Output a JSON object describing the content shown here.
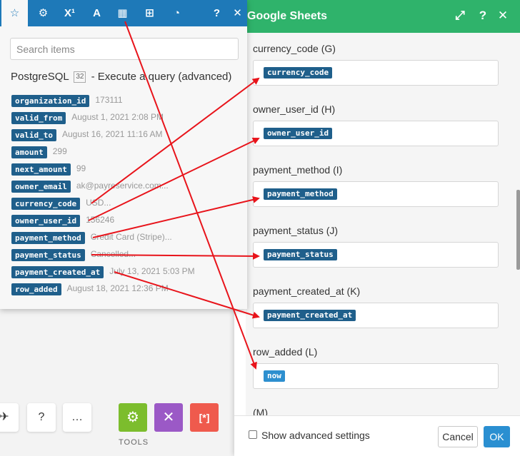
{
  "gs": {
    "title": "Google Sheets",
    "header_icons": [
      "expand-icon",
      "help-icon",
      "close-icon"
    ],
    "fields": [
      {
        "label": "currency_code (G)",
        "value": "currency_code"
      },
      {
        "label": "owner_user_id (H)",
        "value": "owner_user_id"
      },
      {
        "label": "payment_method (I)",
        "value": "payment_method"
      },
      {
        "label": "payment_status (J)",
        "value": "payment_status"
      },
      {
        "label": "payment_created_at (K)",
        "value": "payment_created_at"
      },
      {
        "label": "row_added (L)",
        "value": "now"
      },
      {
        "label": "(M)",
        "value": ""
      }
    ],
    "advanced_label": "Show advanced settings",
    "cancel_label": "Cancel",
    "ok_label": "OK"
  },
  "mapper": {
    "tabs": [
      "star-icon",
      "gear-icon",
      "superscript-icon",
      "text-icon",
      "calendar-icon",
      "table-icon",
      "clock-icon",
      "help-icon",
      "close-icon"
    ],
    "tab_glyphs": [
      "☆",
      "⚙",
      "X¹",
      "A",
      "▦",
      "⊞",
      "◔",
      "?",
      "✕"
    ],
    "search_placeholder": "Search items",
    "module_name": "PostgreSQL",
    "module_badge": "32",
    "module_action": "- Execute a query (advanced)",
    "items": [
      {
        "tag": "organization_id",
        "value": "173111"
      },
      {
        "tag": "valid_from",
        "value": "August 1, 2021 2:08 PM"
      },
      {
        "tag": "valid_to",
        "value": "August 16, 2021 11:16 AM"
      },
      {
        "tag": "amount",
        "value": "299"
      },
      {
        "tag": "next_amount",
        "value": "99"
      },
      {
        "tag": "owner_email",
        "value": "ak@payreservice.com..."
      },
      {
        "tag": "currency_code",
        "value": "USD..."
      },
      {
        "tag": "owner_user_id",
        "value": "156246"
      },
      {
        "tag": "payment_method",
        "value": "Credit Card (Stripe)..."
      },
      {
        "tag": "payment_status",
        "value": "Cancelled..."
      },
      {
        "tag": "payment_created_at",
        "value": "July 13, 2021 5:03 PM"
      },
      {
        "tag": "row_added",
        "value": "August 18, 2021 12:36 PM"
      }
    ]
  },
  "bottom_bar": {
    "buttons": [
      "plane-icon",
      "help-icon",
      "more-icon"
    ],
    "button_glyphs": [
      "✈",
      "?",
      "…"
    ],
    "tools": [
      {
        "name": "gear-tool-icon",
        "glyph": "⚙",
        "color": "#7cbd2d"
      },
      {
        "name": "tools-icon",
        "glyph": "✕",
        "color": "#9b59c6"
      },
      {
        "name": "brackets-icon",
        "glyph": "[*]",
        "color": "#ef5a4d"
      }
    ],
    "tools_label": "TOOLS"
  },
  "annotation_color": "#e8141b"
}
